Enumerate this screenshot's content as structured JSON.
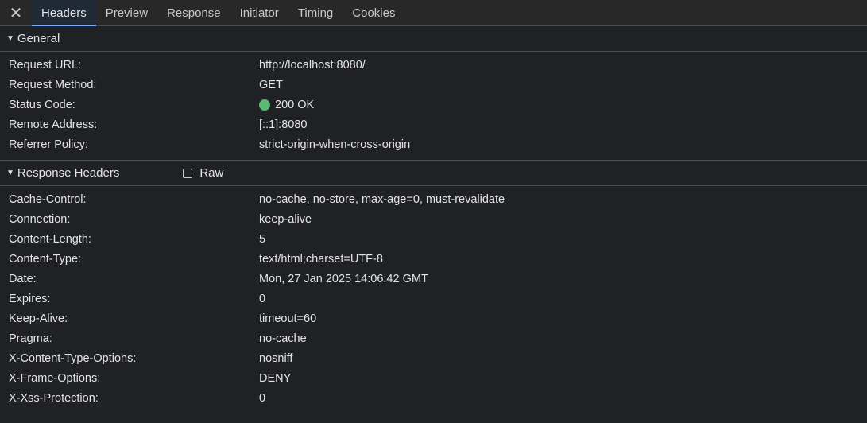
{
  "tabs": {
    "close_glyph": "✕",
    "items": [
      {
        "label": "Headers"
      },
      {
        "label": "Preview"
      },
      {
        "label": "Response"
      },
      {
        "label": "Initiator"
      },
      {
        "label": "Timing"
      },
      {
        "label": "Cookies"
      }
    ],
    "active_index": 0
  },
  "general": {
    "title": "General",
    "rows": [
      {
        "key": "Request URL:",
        "value": "http://localhost:8080/"
      },
      {
        "key": "Request Method:",
        "value": "GET"
      },
      {
        "key": "Status Code:",
        "value": "200 OK",
        "status_color": "#5bb974"
      },
      {
        "key": "Remote Address:",
        "value": "[::1]:8080"
      },
      {
        "key": "Referrer Policy:",
        "value": "strict-origin-when-cross-origin"
      }
    ]
  },
  "response_headers": {
    "title": "Response Headers",
    "raw_label": "Raw",
    "raw_checked": false,
    "rows": [
      {
        "key": "Cache-Control:",
        "value": "no-cache, no-store, max-age=0, must-revalidate"
      },
      {
        "key": "Connection:",
        "value": "keep-alive"
      },
      {
        "key": "Content-Length:",
        "value": "5"
      },
      {
        "key": "Content-Type:",
        "value": "text/html;charset=UTF-8"
      },
      {
        "key": "Date:",
        "value": "Mon, 27 Jan 2025 14:06:42 GMT"
      },
      {
        "key": "Expires:",
        "value": "0"
      },
      {
        "key": "Keep-Alive:",
        "value": "timeout=60"
      },
      {
        "key": "Pragma:",
        "value": "no-cache"
      },
      {
        "key": "X-Content-Type-Options:",
        "value": "nosniff"
      },
      {
        "key": "X-Frame-Options:",
        "value": "DENY"
      },
      {
        "key": "X-Xss-Protection:",
        "value": "0"
      }
    ]
  }
}
